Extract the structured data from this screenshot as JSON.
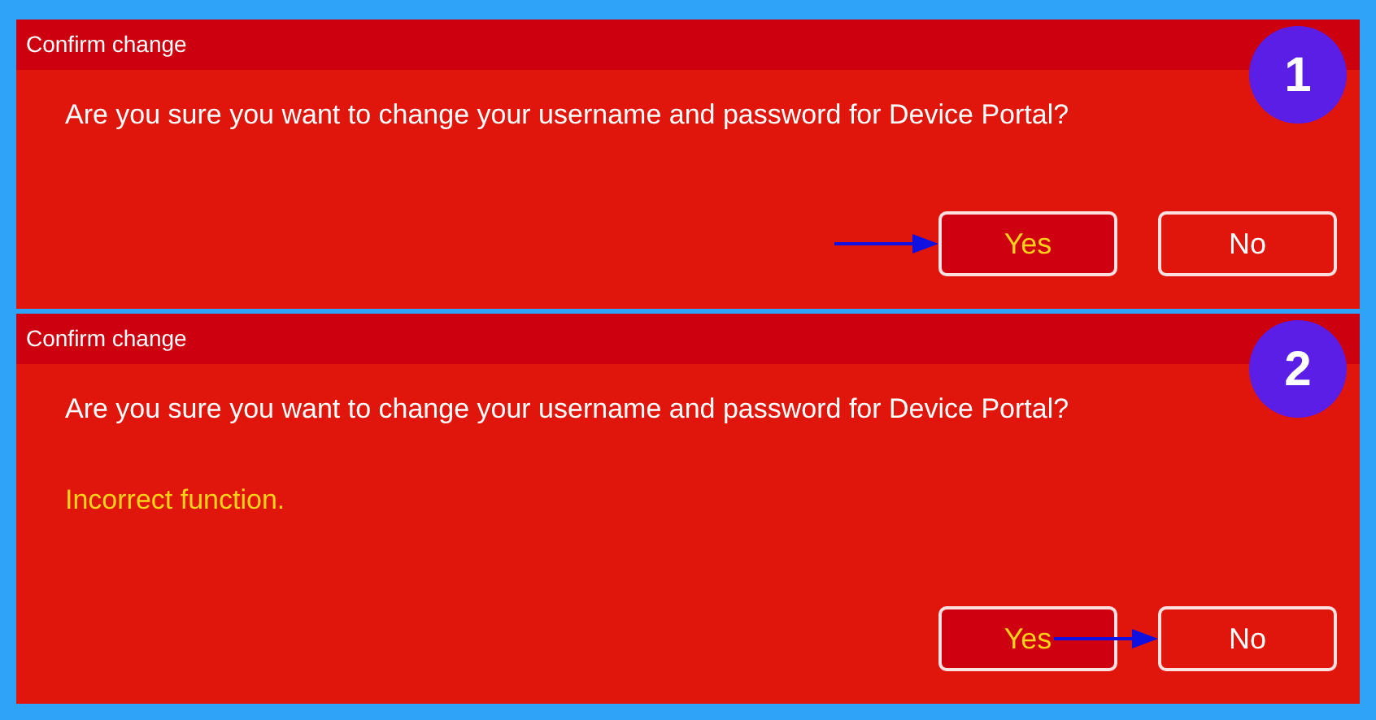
{
  "dialogs": [
    {
      "title": "Confirm change",
      "badge": "1",
      "message": "Are you sure you want to change your username and password for Device Portal?",
      "buttons": [
        {
          "label": "Yes",
          "focused": true,
          "arrow": true
        },
        {
          "label": "No",
          "focused": false,
          "arrow": false
        }
      ]
    },
    {
      "title": "Confirm change",
      "badge": "2",
      "message": "Are you sure you want to change your username and password for Device Portal?",
      "error": "Incorrect function.",
      "buttons": [
        {
          "label": "Yes",
          "focused": true,
          "arrow": false
        },
        {
          "label": "No",
          "focused": false,
          "arrow": true
        }
      ]
    }
  ]
}
